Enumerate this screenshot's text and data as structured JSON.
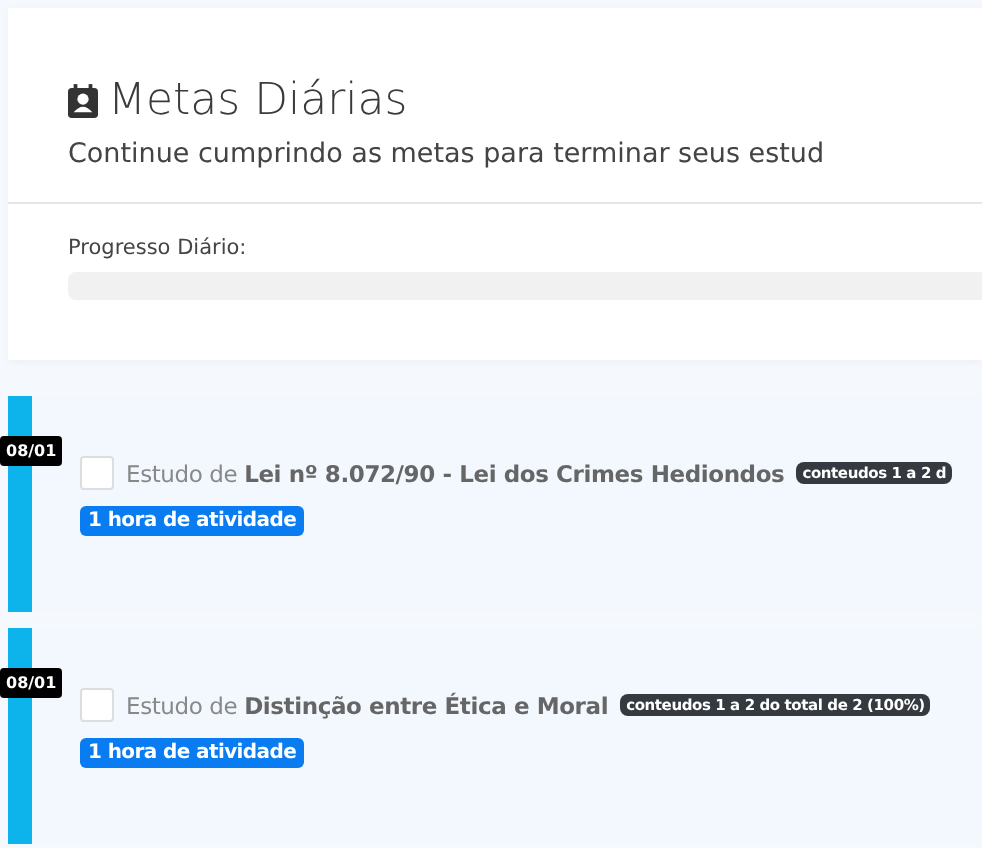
{
  "header": {
    "title": "Metas Diárias",
    "subtitle": "Continue cumprindo as metas para terminar seus estud"
  },
  "progress": {
    "label": "Progresso Diário:",
    "level": 0
  },
  "tasks": [
    {
      "date": "08/01",
      "checked": false,
      "prefix": "Estudo de",
      "topic": "Lei nº 8.072/90 - Lei dos Crimes Hediondos",
      "badge": "conteudos 1 a 2 d",
      "duration": "1 hora de atividade"
    },
    {
      "date": "08/01",
      "checked": false,
      "prefix": "Estudo de",
      "topic": "Distinção entre Ética e Moral",
      "badge": "conteudos 1 a 2 do total de 2 (100%)",
      "duration": "1 hora de atividade"
    }
  ]
}
